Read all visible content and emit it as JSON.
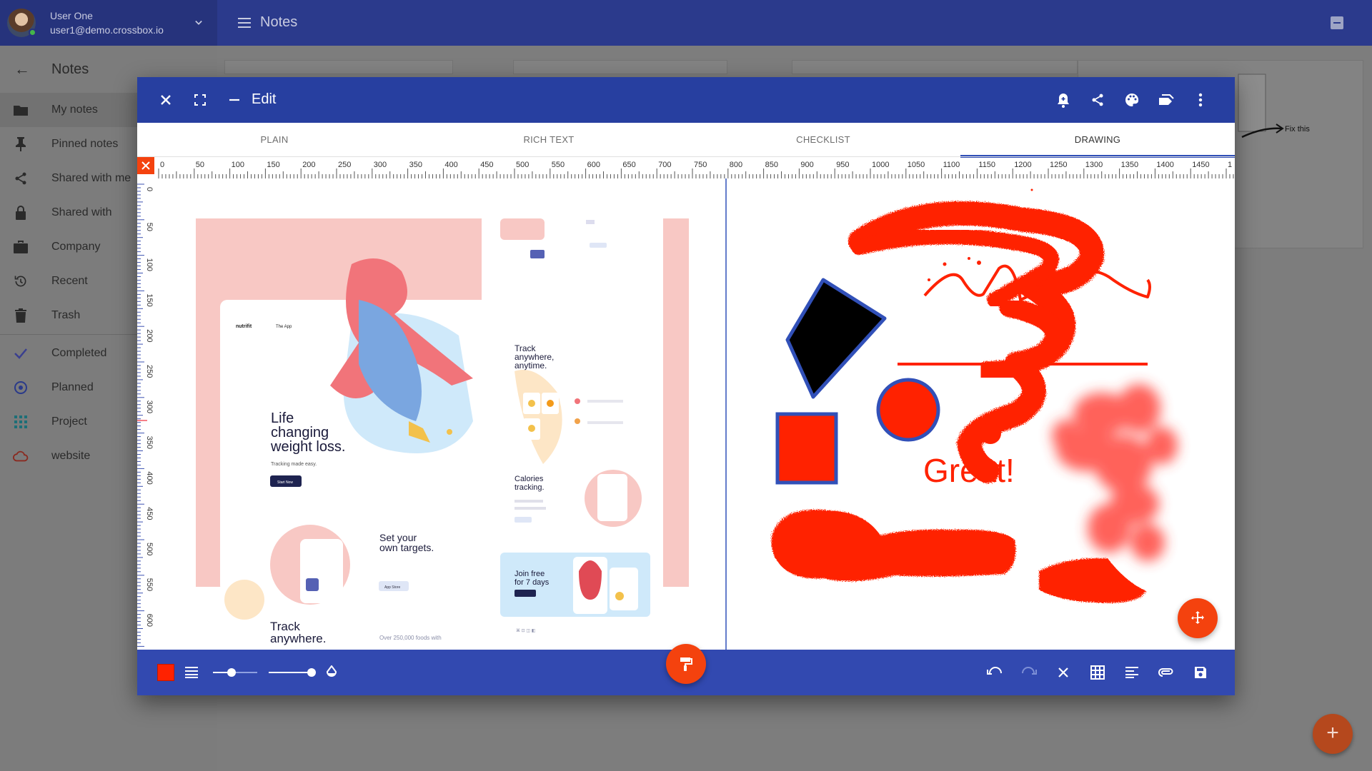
{
  "user": {
    "name": "User One",
    "email": "user1@demo.crossbox.io"
  },
  "header": {
    "title": "Notes"
  },
  "sidebar": {
    "title": "Notes",
    "items": [
      {
        "label": "My notes",
        "icon": "folder-icon"
      },
      {
        "label": "Pinned notes",
        "icon": "pin-icon"
      },
      {
        "label": "Shared with me",
        "icon": "share-icon"
      },
      {
        "label": "Shared with",
        "icon": "lock-icon"
      },
      {
        "label": "Company",
        "icon": "briefcase-icon"
      },
      {
        "label": "Recent",
        "icon": "history-icon"
      },
      {
        "label": "Trash",
        "icon": "trash-icon"
      },
      {
        "label": "Completed",
        "icon": "check-icon"
      },
      {
        "label": "Planned",
        "icon": "target-icon"
      },
      {
        "label": "Project",
        "icon": "grid-icon"
      },
      {
        "label": "website",
        "icon": "cloud-icon"
      }
    ]
  },
  "background_note": {
    "annotation": "Fix this"
  },
  "editor": {
    "title": "Edit",
    "tabs": [
      "PLAIN",
      "RICH TEXT",
      "CHECKLIST",
      "DRAWING"
    ],
    "active_tab": "DRAWING",
    "ruler": {
      "h_labels": [
        "0",
        "50",
        "100",
        "150",
        "200",
        "250",
        "300",
        "350",
        "400",
        "450",
        "500",
        "550",
        "600",
        "650",
        "700",
        "750",
        "800",
        "850",
        "900",
        "950",
        "1000",
        "1050",
        "1100",
        "1150",
        "1200",
        "1250",
        "1300",
        "1350",
        "1400",
        "1450",
        "1"
      ],
      "v_labels": [
        "0",
        "50",
        "100",
        "150",
        "200",
        "250",
        "300",
        "350",
        "400",
        "450",
        "500",
        "550",
        "600",
        "65"
      ]
    },
    "mockup": {
      "hero": [
        "Life",
        "changing",
        "weight loss."
      ],
      "hero_sub": "Tracking made easy.",
      "hero_btn": "Start Now",
      "brand": "nutrifit",
      "nav": "The App",
      "targets": [
        "Set your",
        "own targets."
      ],
      "track": [
        "Track",
        "anywhere,",
        "anytime."
      ],
      "track_bottom": [
        "Track",
        "anywhere."
      ],
      "foods": "Over 250,000 foods with",
      "calories": [
        "Calories",
        "tracking."
      ],
      "join": [
        "Join free",
        "for 7 days"
      ],
      "store": "App Store"
    },
    "drawing": {
      "text": "Great!"
    },
    "colors": {
      "brush": "#ff2200",
      "header": "#273fa0",
      "toolbar": "#3249b0",
      "fab": "#f4420e"
    }
  }
}
